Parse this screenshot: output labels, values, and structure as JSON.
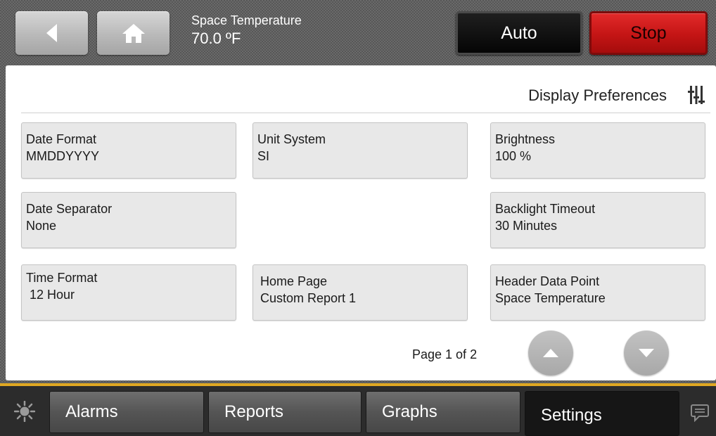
{
  "header": {
    "data_point_label": "Space Temperature",
    "data_point_value": "70.0 ºF",
    "auto_label": "Auto",
    "stop_label": "Stop",
    "icons": {
      "back": "back-arrow-icon",
      "home": "home-icon"
    }
  },
  "page": {
    "title": "Display Preferences",
    "title_icon": "settings-sliders-icon"
  },
  "settings": [
    {
      "label": "Date Format",
      "value": "MMDDYYYY"
    },
    {
      "label": "Unit System",
      "value": "SI"
    },
    {
      "label": "Brightness",
      "value": "100 %"
    },
    {
      "label": "Date Separator",
      "value": "None"
    },
    {
      "label": "Backlight Timeout",
      "value": "30 Minutes"
    },
    {
      "label": "Time Format",
      "value": " 12 Hour"
    },
    {
      "label": "Home Page",
      "value": "Custom Report 1"
    },
    {
      "label": "Header Data Point",
      "value": "Space Temperature"
    }
  ],
  "pagination": {
    "text": "Page 1 of 2",
    "current": 1,
    "total": 2
  },
  "nav": {
    "tabs": [
      {
        "label": "Alarms"
      },
      {
        "label": "Reports"
      },
      {
        "label": "Graphs"
      },
      {
        "label": "Settings",
        "active": true
      }
    ],
    "left_icon": "brightness-icon",
    "right_icon": "chat-icon"
  },
  "colors": {
    "stop": "#c41515",
    "auto": "#050505",
    "accent": "#e0a822",
    "nav_active": "#161616"
  }
}
